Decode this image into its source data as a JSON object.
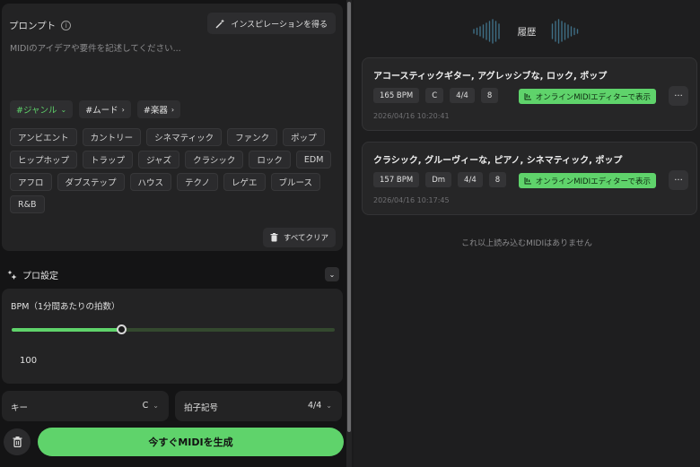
{
  "prompt": {
    "title": "プロンプト",
    "inspire_label": "インスピレーションを得る",
    "placeholder": "MIDIのアイデアや要件を記述してください..."
  },
  "filters": [
    {
      "label": "#ジャンル",
      "active": true
    },
    {
      "label": "#ムード",
      "active": false
    },
    {
      "label": "#楽器",
      "active": false
    }
  ],
  "tags": [
    [
      "アンビエント",
      "カントリー",
      "シネマティック",
      "ファンク",
      "ポップ"
    ],
    [
      "ヒップホップ",
      "トラップ",
      "ジャズ",
      "クラシック",
      "ロック",
      "EDM"
    ],
    [
      "アフロ",
      "ダブステップ",
      "ハウス",
      "テクノ",
      "レゲエ",
      "ブルース"
    ],
    [
      "R&B"
    ]
  ],
  "clear_label": "すべてクリア",
  "pro_settings": {
    "label": "プロ設定"
  },
  "bpm": {
    "label": "BPM（1分間あたりの拍数）",
    "value": "100",
    "fraction": 0.34
  },
  "key": {
    "label": "キー",
    "value": "C"
  },
  "time_signature": {
    "label": "拍子記号",
    "value": "4/4"
  },
  "generate_label": "今すぐMIDIを生成",
  "history": {
    "title": "履歴",
    "items": [
      {
        "title": "アコースティックギター, アグレッシブな, ロック, ポップ",
        "chips": [
          "165 BPM",
          "C",
          "4/4",
          "8"
        ],
        "editor_label": "オンラインMIDIエディターで表示",
        "date": "2026/04/16 10:20:41"
      },
      {
        "title": "クラシック, グルーヴィーな, ピアノ, シネマティック, ポップ",
        "chips": [
          "157 BPM",
          "Dm",
          "4/4",
          "8"
        ],
        "editor_label": "オンラインMIDIエディターで表示",
        "date": "2026/04/16 10:17:45"
      }
    ],
    "no_more": "これ以上読み込むMIDIはありません"
  },
  "colors": {
    "accent": "#5fd36b",
    "background": "#1b1b1c",
    "panel": "#232324"
  },
  "icons": {
    "info": "info-icon",
    "inspire": "magic-wand-icon",
    "clear": "trash-icon",
    "pro": "sparkle-settings-icon",
    "editor": "piano-roll-icon",
    "more": "more-dots-icon"
  }
}
